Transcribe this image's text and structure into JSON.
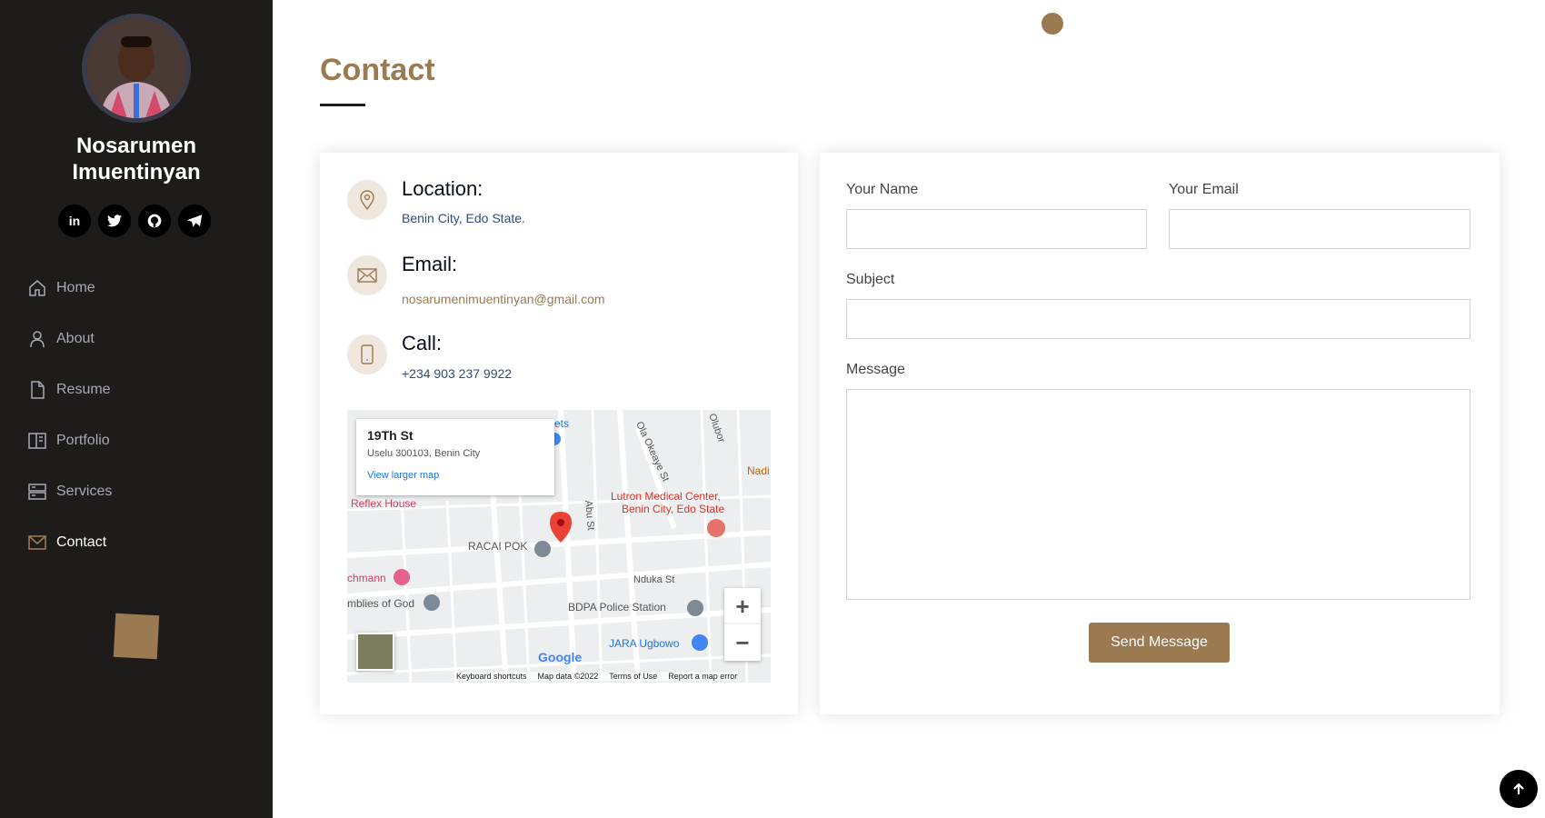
{
  "profile": {
    "name_line1": "Nosarumen",
    "name_line2": "Imuentinyan"
  },
  "socials": [
    {
      "icon": "linkedin-icon",
      "glyph": "in"
    },
    {
      "icon": "twitter-icon",
      "glyph": "🐦"
    },
    {
      "icon": "github-icon",
      "glyph": "◐"
    },
    {
      "icon": "telegram-icon",
      "glyph": "➤"
    }
  ],
  "nav": {
    "items": [
      {
        "label": "Home",
        "icon": "home-icon"
      },
      {
        "label": "About",
        "icon": "user-icon"
      },
      {
        "label": "Resume",
        "icon": "file-icon"
      },
      {
        "label": "Portfolio",
        "icon": "portfolio-icon"
      },
      {
        "label": "Services",
        "icon": "server-icon"
      },
      {
        "label": "Contact",
        "icon": "envelope-icon",
        "active": true
      }
    ]
  },
  "section": {
    "title": "Contact"
  },
  "contact_info": {
    "location_label": "Location:",
    "location_value": "Benin City, Edo State.",
    "email_label": "Email:",
    "email_value": "nosarumenimuentinyan@gmail.com",
    "call_label": "Call:",
    "call_value": "+234 903 237 9922"
  },
  "map": {
    "popup_title": "19Th St",
    "popup_address": "Uselu 300103, Benin City",
    "popup_link": "View larger map",
    "zoom_in": "+",
    "zoom_out": "−",
    "google_logo": "Google",
    "footer": [
      "Keyboard shortcuts",
      "Map data ©2022",
      "Terms of Use",
      "Report a map error"
    ],
    "labels": {
      "reflex_house": "Reflex House",
      "lutron": "Lutron Medical Center,",
      "lutron2": "Benin City, Edo State",
      "racai": "RACAI POK",
      "nduka": "Nduka St",
      "bdpa": "BDPA Police Station",
      "jara": "JARA Ugbowo",
      "chmann": "chmann",
      "assemblies": "mblies of God",
      "nadi": "Nadi",
      "olubor": "Olubor",
      "ola": "Ola Okeaye St",
      "abu": "Abu St",
      "ets": "ets"
    }
  },
  "form": {
    "name_label": "Your Name",
    "email_label": "Your Email",
    "subject_label": "Subject",
    "message_label": "Message",
    "name_value": "",
    "email_value": "",
    "subject_value": "",
    "message_value": "",
    "submit_label": "Send Message"
  },
  "colors": {
    "accent": "#9b7a52",
    "sidebar_bg": "#1d1c1b"
  }
}
